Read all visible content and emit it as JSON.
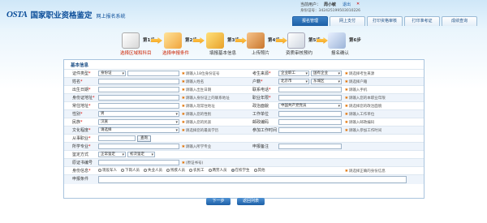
{
  "header": {
    "logo_mark": "OSTA",
    "logo_title": "国家职业资格鉴定",
    "logo_sub": "网上报名系统",
    "user_label": "当前用户：",
    "user_name": "周小敏",
    "logout": "退出",
    "user_info": "身份证号：342425199503010226",
    "nav_tabs": [
      {
        "label": "报名管理",
        "active": true
      },
      {
        "label": "网上支付",
        "active": false
      },
      {
        "label": "打印资格审核",
        "active": false
      },
      {
        "label": "打印准考证",
        "active": false
      },
      {
        "label": "成绩查询",
        "active": false
      }
    ]
  },
  "steps": [
    {
      "num": "第1步",
      "label": "选择区域和科目",
      "state": "done",
      "icon": "document-icon"
    },
    {
      "num": "第2步",
      "label": "选择申报条件",
      "state": "done",
      "icon": "checklist-icon"
    },
    {
      "num": "第3步",
      "label": "填报基本信息",
      "state": "todo",
      "icon": "folder-icon"
    },
    {
      "num": "第4步",
      "label": "上传照片",
      "state": "todo",
      "icon": "photo-icon"
    },
    {
      "num": "第5步",
      "label": "资质审核预约",
      "state": "todo",
      "icon": "calendar-icon"
    },
    {
      "num": "第6步",
      "label": "报名确认",
      "state": "todo",
      "icon": "confirm-icon"
    }
  ],
  "form": {
    "legend": "基本信息",
    "rows": [
      {
        "left_label": "证件类型",
        "left_req": true,
        "left_value": "身份证",
        "left_type": "select",
        "left_hint": "请输入18位身份证号",
        "right_label": "考生来源",
        "right_req": true,
        "right_value": "企业职工",
        "right_value2": "国有企业",
        "right_type": "select2",
        "right_hint": "请选择考生来源"
      },
      {
        "left_label": "姓名",
        "left_req": true,
        "left_value": "",
        "left_type": "input",
        "left_hint": "请输入姓名",
        "right_label": "户籍",
        "right_req": true,
        "right_value": "北京市",
        "right_value2": "东城区",
        "right_type": "select2",
        "right_hint": "请选择户籍"
      },
      {
        "left_label": "出生日期",
        "left_req": true,
        "left_value": "",
        "left_type": "input",
        "left_hint": "请输入出生日期",
        "right_label": "联系电话",
        "right_req": true,
        "right_value": "",
        "right_type": "input",
        "right_hint": "请输入手机"
      },
      {
        "left_label": "身份证地址",
        "left_req": true,
        "left_value": "",
        "left_type": "input",
        "left_hint": "请输入身份证上的联系地址",
        "right_label": "职业年限",
        "right_req": true,
        "right_value": "",
        "right_type": "input",
        "right_hint": "请输入您的本职业年限"
      },
      {
        "left_label": "常住地址",
        "left_req": true,
        "left_value": "",
        "left_type": "input",
        "left_hint": "请输入现常住地址",
        "right_label": "政治面貌",
        "right_req": false,
        "right_value": "中国共产党党员",
        "right_type": "select",
        "right_hint": "请选择您的政治面貌"
      },
      {
        "left_label": "性别",
        "left_req": true,
        "left_value": "男",
        "left_type": "select",
        "left_hint": "请输入您的性别",
        "right_label": "工作单位",
        "right_req": false,
        "right_value": "",
        "right_type": "input",
        "right_hint": "请输入工作单位"
      },
      {
        "left_label": "民族",
        "left_req": true,
        "left_value": "汉族",
        "left_type": "select",
        "left_hint": "请输入您的民族",
        "right_label": "邮政编码",
        "right_req": false,
        "right_value": "",
        "right_type": "input",
        "right_hint": "请输入邮政编码"
      },
      {
        "left_label": "文化程度",
        "left_req": true,
        "left_value": "请选择",
        "left_type": "select",
        "left_hint": "请选择您的最高学历",
        "right_label": "参加工作时间",
        "right_req": false,
        "right_value": "",
        "right_type": "input",
        "right_hint": "请输入参加工作时间"
      }
    ],
    "occupation_label": "从事职业",
    "occupation_button": "查询",
    "major_label": "所学专业",
    "major_hint": "请输入所学专业",
    "declare_label": "申报备注",
    "level_label": "鉴定方式",
    "level_value": "正常鉴定",
    "level_value2": "初次鉴定",
    "cert_no_label": "原证书编号",
    "cert_no_hint": "(原证书号)",
    "identity_label": "身份信息",
    "identity_options": [
      {
        "label": "现役军人",
        "on": false
      },
      {
        "label": "下岗人员",
        "on": false
      },
      {
        "label": "失业人员",
        "on": false
      },
      {
        "label": "残疾人员",
        "on": false
      },
      {
        "label": "农民工",
        "on": false
      },
      {
        "label": "两劳人员",
        "on": false
      },
      {
        "label": "在校学生",
        "on": true
      },
      {
        "label": "其他",
        "on": false
      }
    ],
    "identity_hint": "请选择正确的身份信息",
    "condition_label": "申报条件"
  },
  "buttons": {
    "next": "下一步",
    "back": "返回列表"
  }
}
